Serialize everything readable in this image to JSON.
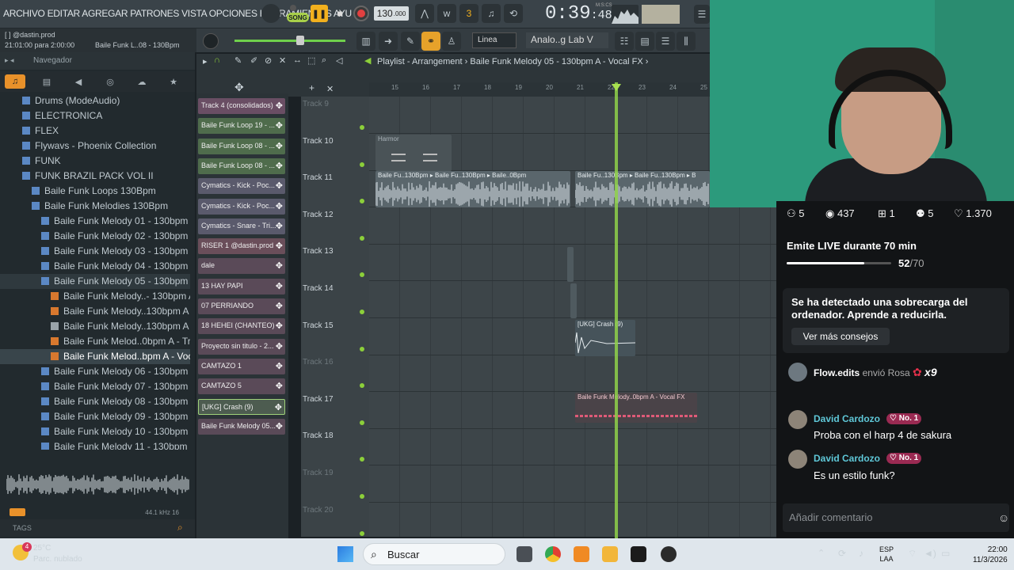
{
  "app": {
    "menu": "ARCHIVO EDITAR AGREGAR PATRONES VISTA OPCIONES HERRAMIENTAS AYU",
    "song_mode": "SONG",
    "tempo": "130",
    "tempo_decimal": ".000",
    "time": "0:39",
    "time_sub": ":48",
    "time_units": "M:S:CS",
    "snap": "Linea",
    "channel": "Analo..g Lab V",
    "hint_user": "[ ] @dastin.prod",
    "hint_time": "21:01:00 para 2:00:00",
    "hint_file": "Baile Funk L..08 - 130Bpm"
  },
  "browser": {
    "title": "Navegador",
    "tabs": [
      "♫",
      "▤",
      "◀",
      "◎",
      "☁",
      "★"
    ],
    "items": [
      {
        "label": "Drums (ModeAudio)",
        "indent": 0,
        "type": "folder"
      },
      {
        "label": "ELECTRONICA",
        "indent": 0,
        "type": "folder"
      },
      {
        "label": "FLEX",
        "indent": 0,
        "type": "folder"
      },
      {
        "label": "Flywavs - Phoenix Collection",
        "indent": 0,
        "type": "folder"
      },
      {
        "label": "FUNK",
        "indent": 0,
        "type": "folder"
      },
      {
        "label": "FUNK BRAZIL PACK VOL II",
        "indent": 0,
        "type": "folder"
      },
      {
        "label": "Baile Funk Loops 130Bpm",
        "indent": 1,
        "type": "folder"
      },
      {
        "label": "Baile Funk Melodies 130Bpm",
        "indent": 1,
        "type": "folder"
      },
      {
        "label": "Baile Funk Melody 01 - 130bpm A",
        "indent": 2,
        "type": "folder"
      },
      {
        "label": "Baile Funk Melody 02 - 130bpm A",
        "indent": 2,
        "type": "folder"
      },
      {
        "label": "Baile Funk Melody 03 - 130bpm G#",
        "indent": 2,
        "type": "folder"
      },
      {
        "label": "Baile Funk Melody 04 - 130bpm B",
        "indent": 2,
        "type": "folder"
      },
      {
        "label": "Baile Funk Melody 05 - 130bpm A",
        "indent": 2,
        "type": "folder"
      },
      {
        "label": "Baile Funk Melody..- 130bpm A - Mix",
        "indent": 3,
        "type": "audio"
      },
      {
        "label": "Baile Funk Melody..130bpm A - Brass",
        "indent": 3,
        "type": "audio"
      },
      {
        "label": "Baile Funk Melody..130bpm A - Midi",
        "indent": 3,
        "type": "midi"
      },
      {
        "label": "Baile Funk Melod..0bpm A - Trumpet",
        "indent": 3,
        "type": "audio"
      },
      {
        "label": "Baile Funk Melod..bpm A - Vocal FX",
        "indent": 3,
        "type": "audio"
      },
      {
        "label": "Baile Funk Melody 06 - 130bpm G#",
        "indent": 2,
        "type": "folder"
      },
      {
        "label": "Baile Funk Melody 07 - 130bpm A",
        "indent": 2,
        "type": "folder"
      },
      {
        "label": "Baile Funk Melody 08 - 130bpm B",
        "indent": 2,
        "type": "folder"
      },
      {
        "label": "Baile Funk Melody 09 - 130bpm A",
        "indent": 2,
        "type": "folder"
      },
      {
        "label": "Baile Funk Melody 10 - 130bpm A",
        "indent": 2,
        "type": "folder"
      },
      {
        "label": "Baile Funk Melody 11 - 130bpm C#",
        "indent": 2,
        "type": "folder"
      }
    ],
    "sample_info": "44.1 kHz 16",
    "tags_label": "TAGS"
  },
  "playlist": {
    "title": "Playlist - Arrangement › Baile Funk Melody 05 - 130bpm A - Vocal FX ›",
    "ruler": [
      "15",
      "16",
      "17",
      "18",
      "19",
      "20",
      "21",
      "22",
      "23",
      "24",
      "25"
    ],
    "tracks": [
      "Track 9",
      "Track 10",
      "Track 11",
      "Track 12",
      "Track 13",
      "Track 14",
      "Track 15",
      "Track 16",
      "Track 17",
      "Track 18",
      "Track 19",
      "Track 20"
    ],
    "patterns": [
      "Track 4 (consolidados)",
      "Baile Funk Loop 19 - ...",
      "Baile Funk Loop 08 - ...",
      "Baile Funk Loop 08 - ...",
      "Cymatics - Kick - Poc...",
      "Cymatics - Kick - Poc...",
      "Cymatics - Snare - Tri...",
      "RISER 1 @dastin.prod",
      "dale",
      "13 HAY PAPI",
      "07 PERRIANDO",
      "18 HEHEI (CHANTEO)",
      "Proyecto sin titulo - 2...",
      "CAMTAZO 1",
      "CAMTAZO 5",
      "[UKG] Crash (9)",
      "Baile Funk Melody 05..."
    ],
    "clips": {
      "harmor": "Harmor",
      "loop_a": "Baile Fu..130Bpm ▸ Baile Fu..130Bpm ▸ Baile..0Bpm",
      "loop_b": "Baile Fu..130Bpm ▸ Baile Fu..130Bpm ▸ B",
      "crash": "[UKG] Crash (9)",
      "vocal": "Baile Funk Melody..0bpm A - Vocal FX"
    }
  },
  "stream": {
    "viewers": "5",
    "views": "437",
    "gifts": "1",
    "followers": "5",
    "likes": "1.370",
    "live_title": "Emite LIVE durante 70 min",
    "live_progress": "52",
    "live_total": "/70",
    "live_fraction": 0.743,
    "alert": "Se ha detectado una sobrecarga del ordenador. Aprende a reducirla.",
    "alert_button": "Ver más consejos",
    "gift_user": "Flow.edits",
    "gift_text": "envió Rosa",
    "gift_count": "x9",
    "comments": [
      {
        "user": "David Cardozo",
        "badge": "No. 1",
        "text": "Proba con el harp 4 de sakura"
      },
      {
        "user": "David Cardozo",
        "badge": "No. 1",
        "text": "Es un estilo funk?"
      }
    ],
    "comment_placeholder": "Añadir comentario"
  },
  "taskbar": {
    "temp": "25°C",
    "weather": "Parc. nublado",
    "weather_badge": "4",
    "search": "Buscar",
    "lang": "ESP",
    "lang2": "LAA",
    "time": "22:00",
    "date": "11/3/2026"
  }
}
